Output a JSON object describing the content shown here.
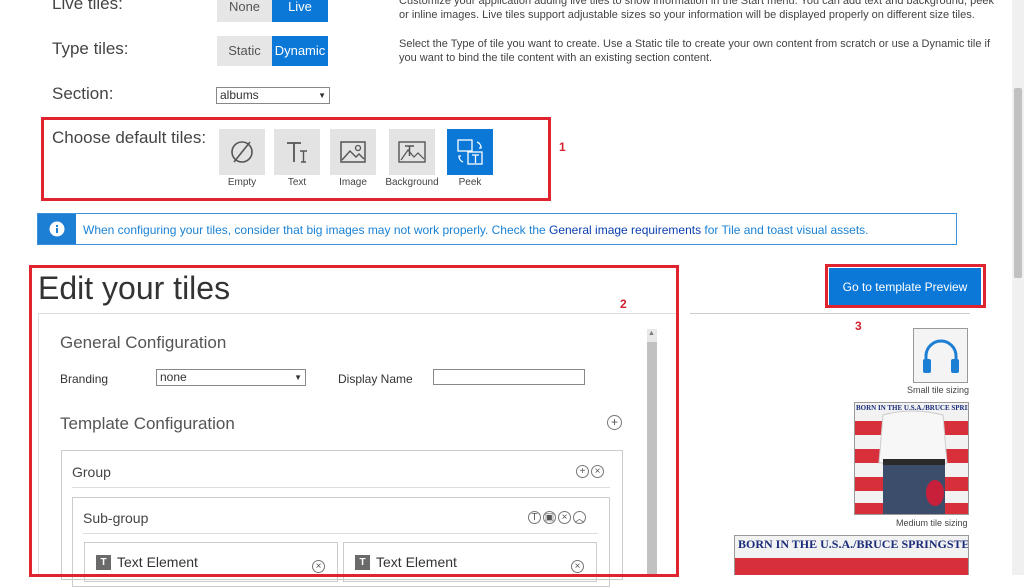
{
  "config_rows": {
    "live_tiles": {
      "label": "Live tiles:",
      "options": [
        "None",
        "Live"
      ],
      "selected": "Live"
    },
    "type_tiles": {
      "label": "Type tiles:",
      "options": [
        "Static",
        "Dynamic"
      ],
      "selected": "Dynamic"
    },
    "section": {
      "label": "Section:",
      "value": "albums"
    },
    "default_tiles": {
      "label": "Choose default tiles:",
      "tiles": [
        "Empty",
        "Text",
        "Image",
        "Background",
        "Peek"
      ],
      "selected": "Peek"
    }
  },
  "descriptions": {
    "live_tiles_line1": "Customize your application adding live tiles to show information in the Start menu. You can add text and background, peek",
    "live_tiles_line2": "or inline images. Live tiles support adjustable sizes so your information will be displayed properly on different size tiles.",
    "type_tiles_line1": "Select the Type of tile you want to create. Use a Static tile to create your own content from scratch or use a Dynamic tile if",
    "type_tiles_line2": "you want to bind the tile content with an existing section content."
  },
  "info_bar": {
    "text_before": "When configuring your tiles, consider that big images may not work properly. Check the ",
    "link": "General image requirements",
    "text_after": " for Tile and toast visual assets."
  },
  "annotations": [
    "1",
    "2",
    "3"
  ],
  "editor": {
    "title": "Edit your tiles",
    "general_config": "General Configuration",
    "branding_label": "Branding",
    "branding_value": "none",
    "display_name_label": "Display Name",
    "display_name_value": "",
    "template_config": "Template Configuration",
    "group_label": "Group",
    "subgroup_label": "Sub-group",
    "text_elements": [
      "Text Element",
      "Text Element"
    ]
  },
  "preview": {
    "button_label": "Go to template Preview",
    "small_caption": "Small tile sizing",
    "medium_caption": "Medium tile sizing",
    "banner_text_medium": "BORN IN THE U.S.A./BRUCE SPRINGSTEEN",
    "banner_text_wide": "BORN IN THE U.S.A./BRUCE SPRINGSTEEN"
  },
  "colors": {
    "accent": "#0b78d7",
    "annotation_red": "#e0242f",
    "info_border": "#3c93db"
  }
}
